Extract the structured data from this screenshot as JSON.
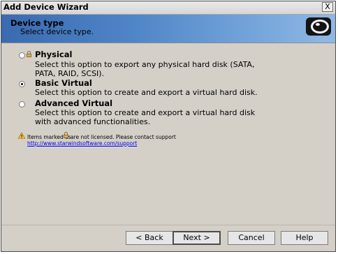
{
  "window": {
    "title": "Add Device Wizard",
    "close_label": "X"
  },
  "header": {
    "title": "Device type",
    "subtitle": "Select device type.",
    "logo_icon": "starwind-logo-icon"
  },
  "options": [
    {
      "label": "Physical",
      "selected": false,
      "licensed": false,
      "description": [
        "Select this option to export any physical hard disk (SATA,",
        "PATA, RAID, SCSI)."
      ]
    },
    {
      "label": "Basic Virtual",
      "selected": true,
      "licensed": true,
      "description": [
        "Select this option to create and export a virtual hard disk."
      ]
    },
    {
      "label": "Advanced Virtual",
      "selected": false,
      "licensed": true,
      "description": [
        "Select this option to create and export a virtual hard disk",
        "with advanced functionalities."
      ]
    }
  ],
  "note": {
    "text_before": "Items marked as",
    "text_after": "are not licensed. Please contact support",
    "link": "http://www.starwindsoftware.com/support"
  },
  "buttons": {
    "back": "< Back",
    "next": "Next >",
    "cancel": "Cancel",
    "help": "Help"
  },
  "colors": {
    "header_start": "#3a6ab0",
    "header_end": "#8fb9e6",
    "dialog_bg": "#d4d0c8",
    "link": "#0000ee"
  }
}
